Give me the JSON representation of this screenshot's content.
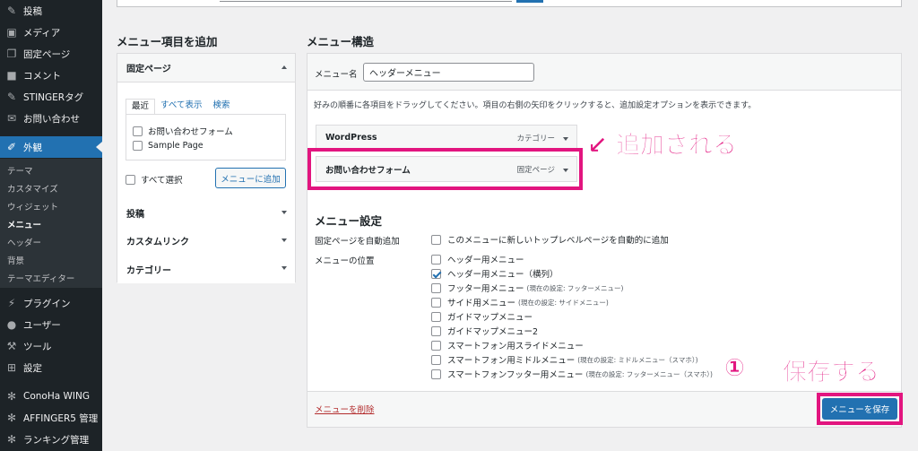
{
  "sidebar": {
    "items": [
      {
        "label": "投稿",
        "icon": "pin-icon",
        "glyph": "✎"
      },
      {
        "label": "メディア",
        "icon": "media-icon",
        "glyph": "▣"
      },
      {
        "label": "固定ページ",
        "icon": "page-icon",
        "glyph": "❐"
      },
      {
        "label": "コメント",
        "icon": "comment-icon",
        "glyph": "■"
      },
      {
        "label": "STINGERタグ",
        "icon": "pin-icon",
        "glyph": "✎"
      },
      {
        "label": "お問い合わせ",
        "icon": "mail-icon",
        "glyph": "✉"
      },
      {
        "label": "外観",
        "icon": "brush-icon",
        "glyph": "✐"
      }
    ],
    "submenu": [
      "テーマ",
      "カスタマイズ",
      "ウィジェット",
      "メニュー",
      "ヘッダー",
      "背景",
      "テーマエディター"
    ],
    "items_bottom": [
      {
        "label": "プラグイン",
        "icon": "plugin-icon",
        "glyph": "⚡"
      },
      {
        "label": "ユーザー",
        "icon": "user-icon",
        "glyph": "●"
      },
      {
        "label": "ツール",
        "icon": "wrench-icon",
        "glyph": "⚒"
      },
      {
        "label": "設定",
        "icon": "settings-icon",
        "glyph": "⊞"
      },
      {
        "label": "ConoHa WING",
        "icon": "gear-icon",
        "glyph": "✻"
      },
      {
        "label": "AFFINGER5 管理",
        "icon": "gear-icon",
        "glyph": "✻"
      },
      {
        "label": "ランキング管理",
        "icon": "gear-icon",
        "glyph": "✻"
      }
    ]
  },
  "add_items": {
    "title": "メニュー項目を追加",
    "open_section": "固定ページ",
    "tabs": [
      "最近",
      "すべて表示",
      "検索"
    ],
    "pages": [
      "お問い合わせフォーム",
      "Sample Page"
    ],
    "select_all": "すべて選択",
    "add_button": "メニューに追加",
    "sections": [
      "投稿",
      "カスタムリンク",
      "カテゴリー"
    ]
  },
  "structure": {
    "title": "メニュー構造",
    "name_label": "メニュー名",
    "name_value": "ヘッダーメニュー",
    "hint": "好みの順番に各項目をドラッグしてください。項目の右側の矢印をクリックすると、追加設定オプションを表示できます。",
    "items": [
      {
        "title": "WordPress",
        "type": "カテゴリー"
      },
      {
        "title": "お問い合わせフォーム",
        "type": "固定ページ"
      }
    ]
  },
  "settings": {
    "title": "メニュー設定",
    "auto_add_label": "固定ページを自動追加",
    "auto_add_option": "このメニューに新しいトップレベルページを自動的に追加",
    "location_label": "メニューの位置",
    "locations": [
      {
        "label": "ヘッダー用メニュー",
        "note": "",
        "checked": false
      },
      {
        "label": "ヘッダー用メニュー（横列）",
        "note": "",
        "checked": true
      },
      {
        "label": "フッター用メニュー",
        "note": "(現在の設定: フッターメニュー)",
        "checked": false
      },
      {
        "label": "サイド用メニュー",
        "note": "(現在の設定: サイドメニュー)",
        "checked": false
      },
      {
        "label": "ガイドマップメニュー",
        "note": "",
        "checked": false
      },
      {
        "label": "ガイドマップメニュー2",
        "note": "",
        "checked": false
      },
      {
        "label": "スマートフォン用スライドメニュー",
        "note": "",
        "checked": false
      },
      {
        "label": "スマートフォン用ミドルメニュー",
        "note": "(現在の設定: ミドルメニュー（スマホ）)",
        "checked": false
      },
      {
        "label": "スマートフォンフッター用メニュー",
        "note": "(現在の設定: フッターメニュー（スマホ）)",
        "checked": false
      }
    ]
  },
  "footer": {
    "delete_link": "メニューを削除",
    "save_button": "メニューを保存"
  },
  "annotations": {
    "added": "↙ 追加される",
    "step": "①",
    "save": "保存する"
  },
  "colors": {
    "sidebar_bg": "#1d2327",
    "accent": "#2271b1",
    "annotation": "#e2157f",
    "danger": "#b32d2e"
  }
}
